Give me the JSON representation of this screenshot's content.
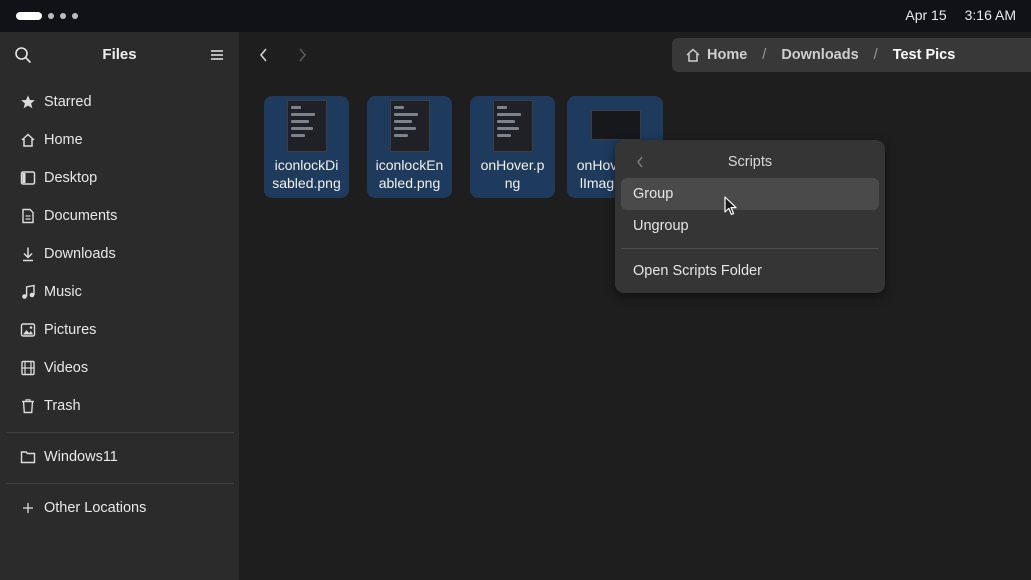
{
  "topbar": {
    "date": "Apr 15",
    "time": "3:16 AM"
  },
  "sidebar": {
    "title": "Files",
    "items": [
      {
        "label": "Starred",
        "icon": "star-icon"
      },
      {
        "label": "Home",
        "icon": "home-icon"
      },
      {
        "label": "Desktop",
        "icon": "desktop-icon"
      },
      {
        "label": "Documents",
        "icon": "documents-icon"
      },
      {
        "label": "Downloads",
        "icon": "downloads-icon"
      },
      {
        "label": "Music",
        "icon": "music-icon"
      },
      {
        "label": "Pictures",
        "icon": "pictures-icon"
      },
      {
        "label": "Videos",
        "icon": "videos-icon"
      },
      {
        "label": "Trash",
        "icon": "trash-icon"
      }
    ],
    "drives": [
      {
        "label": "Windows11",
        "icon": "folder-icon"
      }
    ],
    "other": {
      "label": "Other Locations",
      "icon": "plus-icon"
    }
  },
  "breadcrumb": {
    "home": "Home",
    "parent": "Downloads",
    "current": "Test Pics",
    "separator": "/"
  },
  "files": [
    {
      "line1": "iconlockDi",
      "line2": "sabled.png"
    },
    {
      "line1": "iconlockEn",
      "line2": "abled.png"
    },
    {
      "line1": "onHover.p",
      "line2": "ng"
    },
    {
      "line1": "onHov",
      "line2": "lImag"
    }
  ],
  "popover": {
    "title": "Scripts",
    "items": [
      "Group",
      "Ungroup"
    ],
    "footer_item": "Open Scripts Folder"
  },
  "colors": {
    "selection": "#1e3a5c",
    "sidebar": "#2b2b2b",
    "background": "#1e1e1e",
    "popover": "#353535"
  }
}
